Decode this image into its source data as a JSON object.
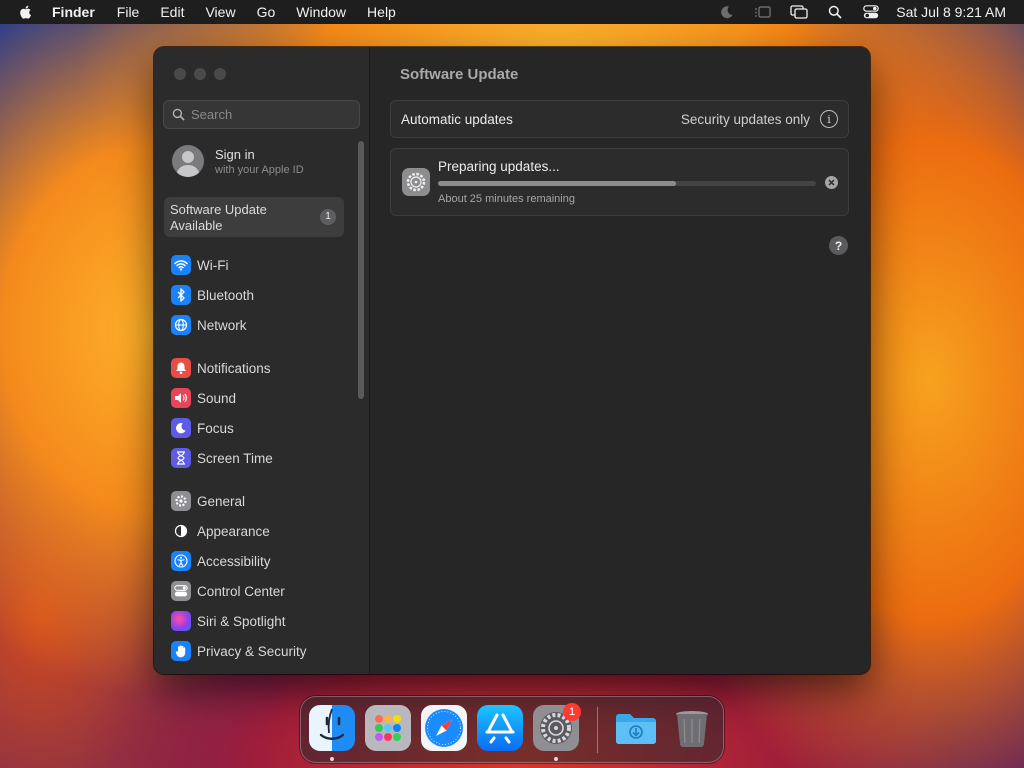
{
  "menubar": {
    "apple_icon": "apple-logo-icon",
    "app_name": "Finder",
    "items": [
      "File",
      "Edit",
      "View",
      "Go",
      "Window",
      "Help"
    ],
    "status_icons": [
      "focus-moon-icon",
      "stage-manager-icon",
      "screen-mirroring-icon",
      "spotlight-search-icon",
      "control-center-icon"
    ],
    "clock": "Sat Jul 8  9:21 AM"
  },
  "window": {
    "sidebar": {
      "search_placeholder": "Search",
      "signin": {
        "title": "Sign in",
        "subtitle": "with your Apple ID"
      },
      "software_update": {
        "label_line1": "Software Update",
        "label_line2": "Available",
        "badge": "1"
      },
      "items": [
        {
          "label": "Wi-Fi",
          "icon": "wifi-icon",
          "color": "#1a82fb"
        },
        {
          "label": "Bluetooth",
          "icon": "bluetooth-icon",
          "color": "#1a82fb"
        },
        {
          "label": "Network",
          "icon": "network-globe-icon",
          "color": "#1a82fb"
        },
        {
          "label": "Notifications",
          "icon": "notifications-bell-icon",
          "color": "#ea4d44"
        },
        {
          "label": "Sound",
          "icon": "sound-speaker-icon",
          "color": "#e8445a"
        },
        {
          "label": "Focus",
          "icon": "focus-moon-icon",
          "color": "#5e5ce6"
        },
        {
          "label": "Screen Time",
          "icon": "screen-time-hourglass-icon",
          "color": "#5e5ce6"
        },
        {
          "label": "General",
          "icon": "general-gear-icon",
          "color": "#8e8e93"
        },
        {
          "label": "Appearance",
          "icon": "appearance-icon",
          "color": "#2c2c2e"
        },
        {
          "label": "Accessibility",
          "icon": "accessibility-icon",
          "color": "#1a82fb"
        },
        {
          "label": "Control Center",
          "icon": "control-center-icon",
          "color": "#8e8e93"
        },
        {
          "label": "Siri & Spotlight",
          "icon": "siri-icon",
          "color": "#b03ad6"
        },
        {
          "label": "Privacy & Security",
          "icon": "privacy-hand-icon",
          "color": "#1a82fb"
        }
      ]
    },
    "content": {
      "title": "Software Update",
      "automatic_updates": {
        "label": "Automatic updates",
        "value": "Security updates only"
      },
      "update": {
        "title": "Preparing updates...",
        "subtitle": "About 25 minutes remaining",
        "progress": 0.63
      }
    }
  },
  "dock": {
    "apps": [
      {
        "name": "Finder",
        "icon": "finder-icon",
        "running": true
      },
      {
        "name": "Launchpad",
        "icon": "launchpad-icon",
        "running": false
      },
      {
        "name": "Safari",
        "icon": "safari-icon",
        "running": false
      },
      {
        "name": "App Store",
        "icon": "app-store-icon",
        "running": false
      },
      {
        "name": "System Settings",
        "icon": "system-settings-icon",
        "running": true,
        "badge": "1"
      }
    ],
    "others": [
      {
        "name": "Downloads",
        "icon": "downloads-folder-icon"
      },
      {
        "name": "Trash",
        "icon": "trash-icon"
      }
    ]
  }
}
